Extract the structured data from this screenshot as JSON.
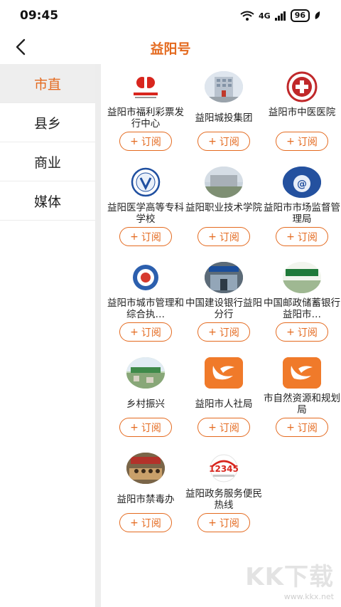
{
  "status": {
    "time": "09:45",
    "network": "4G",
    "battery": "96"
  },
  "header": {
    "title": "益阳号"
  },
  "sidebar": {
    "items": [
      {
        "label": "市直",
        "active": true
      },
      {
        "label": "县乡",
        "active": false
      },
      {
        "label": "商业",
        "active": false
      },
      {
        "label": "媒体",
        "active": false
      }
    ]
  },
  "subscribe_label": "订阅",
  "accounts": [
    {
      "name": "益阳市福利彩票发行中心",
      "icon": "welfare-lottery-logo"
    },
    {
      "name": "益阳城投集团",
      "icon": "building-photo"
    },
    {
      "name": "益阳市中医医院",
      "icon": "tcm-hospital-logo"
    },
    {
      "name": "益阳医学高等专科学校",
      "icon": "medical-college-logo"
    },
    {
      "name": "益阳职业技术学院",
      "icon": "campus-photo"
    },
    {
      "name": "益阳市市场监督管理局",
      "icon": "market-supervision-logo"
    },
    {
      "name": "益阳市城市管理和综合执…",
      "icon": "city-management-emblem"
    },
    {
      "name": "中国建设银行益阳分行",
      "icon": "bank-branch-photo"
    },
    {
      "name": "中国邮政储蓄银行益阳市…",
      "icon": "postal-bank-photo"
    },
    {
      "name": "乡村振兴",
      "icon": "rural-revitalization-photo"
    },
    {
      "name": "益阳市人社局",
      "icon": "app-default-logo"
    },
    {
      "name": "市自然资源和规划局",
      "icon": "app-default-logo"
    },
    {
      "name": "益阳市禁毒办",
      "icon": "anti-drug-photo"
    },
    {
      "name": "益阳政务服务便民热线",
      "icon": "hotline-12345-logo"
    }
  ],
  "watermark": {
    "logo": "KK下载",
    "url": "www.kkx.net"
  },
  "colors": {
    "accent": "#e46a1f",
    "sidebar_active_bg": "#eeeeee"
  }
}
